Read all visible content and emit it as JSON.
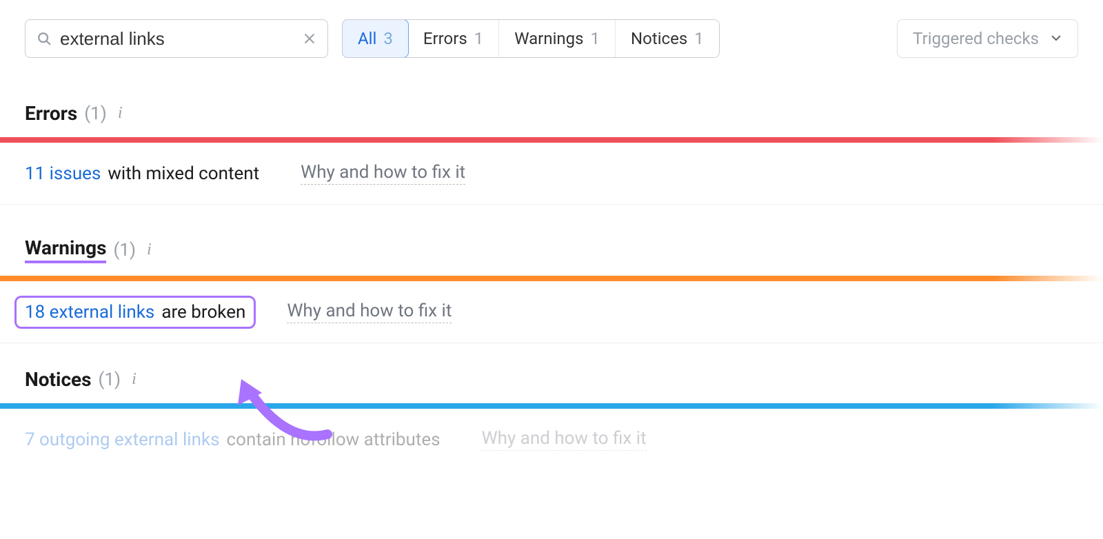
{
  "search": {
    "value": "external links"
  },
  "tabs": {
    "all": {
      "label": "All",
      "count": "3"
    },
    "errors": {
      "label": "Errors",
      "count": "1"
    },
    "warnings": {
      "label": "Warnings",
      "count": "1"
    },
    "notices": {
      "label": "Notices",
      "count": "1"
    }
  },
  "dropdown": {
    "label": "Triggered checks"
  },
  "sections": {
    "errors": {
      "title": "Errors",
      "count": "(1)"
    },
    "warnings": {
      "title": "Warnings",
      "count": "(1)"
    },
    "notices": {
      "title": "Notices",
      "count": "(1)"
    }
  },
  "rows": {
    "error1": {
      "link": "11 issues",
      "text": "with mixed content",
      "fix": "Why and how to fix it"
    },
    "warning1": {
      "link": "18 external links",
      "text": "are broken",
      "fix": "Why and how to fix it"
    },
    "notice1": {
      "link": "7 outgoing external links",
      "text": "contain nofollow attributes",
      "fix": "Why and how to fix it"
    }
  },
  "colors": {
    "accent_blue": "#1a6bd8",
    "highlight_purple": "#a972ff",
    "error_red": "#f04f5a",
    "warning_orange": "#ff8b2a",
    "notice_blue": "#2aa7ea"
  }
}
